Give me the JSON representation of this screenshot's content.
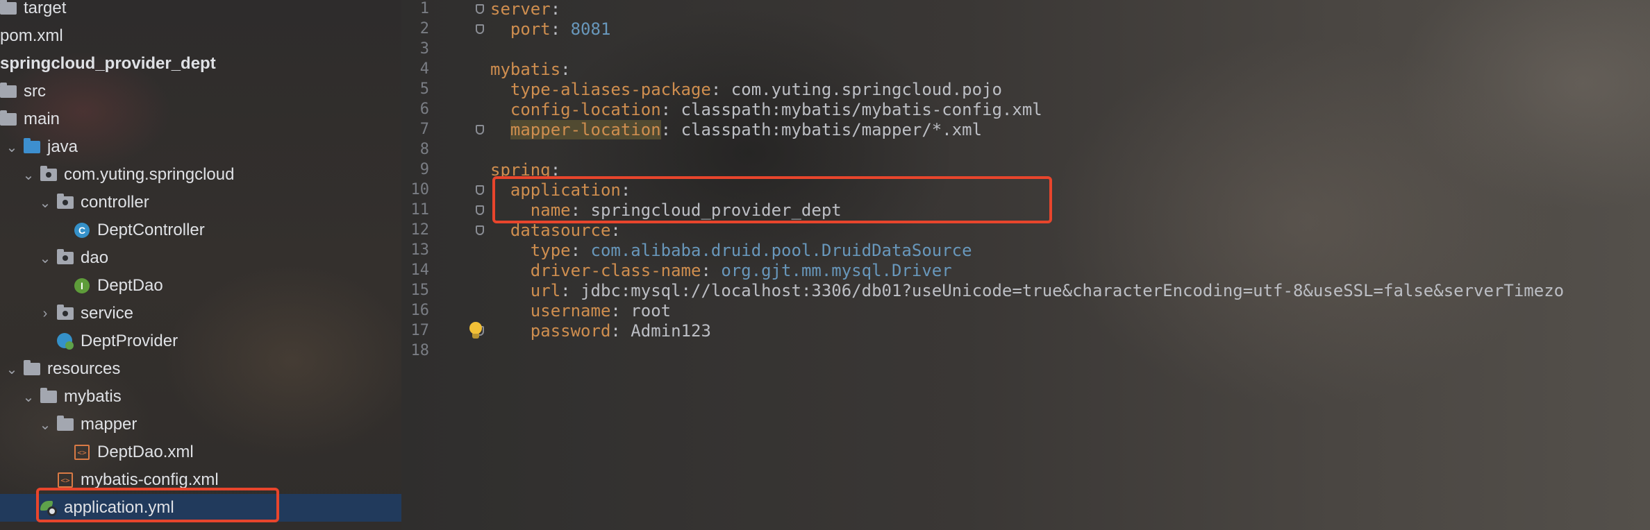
{
  "tree": {
    "rows": [
      {
        "label": "target",
        "indent": 0,
        "icon": "folder"
      },
      {
        "label": "pom.xml",
        "indent": 0,
        "icon": "maven-file"
      },
      {
        "label": "springcloud_provider_dept",
        "indent": 0,
        "icon": "module",
        "bold": true
      },
      {
        "label": "src",
        "indent": 0,
        "icon": "folder"
      },
      {
        "label": "main",
        "indent": 0,
        "icon": "folder"
      },
      {
        "label": "java",
        "indent": 1,
        "icon": "source-folder",
        "expanded": true
      },
      {
        "label": "com.yuting.springcloud",
        "indent": 2,
        "icon": "package",
        "expanded": true
      },
      {
        "label": "controller",
        "indent": 3,
        "icon": "package",
        "expanded": true
      },
      {
        "label": "DeptController",
        "indent": 4,
        "icon": "class"
      },
      {
        "label": "dao",
        "indent": 3,
        "icon": "package",
        "expanded": true
      },
      {
        "label": "DeptDao",
        "indent": 4,
        "icon": "interface"
      },
      {
        "label": "service",
        "indent": 3,
        "icon": "package",
        "expanded": false
      },
      {
        "label": "DeptProvider",
        "indent": 3,
        "icon": "spring-boot-class"
      },
      {
        "label": "resources",
        "indent": 1,
        "icon": "resources-folder",
        "expanded": true
      },
      {
        "label": "mybatis",
        "indent": 2,
        "icon": "folder",
        "expanded": true
      },
      {
        "label": "mapper",
        "indent": 3,
        "icon": "folder",
        "expanded": true
      },
      {
        "label": "DeptDao.xml",
        "indent": 4,
        "icon": "xml-file"
      },
      {
        "label": "mybatis-config.xml",
        "indent": 3,
        "icon": "xml-file"
      },
      {
        "label": "application.yml",
        "indent": 2,
        "icon": "yaml-file",
        "selected": true
      }
    ]
  },
  "editor": {
    "lines": [
      {
        "num": "1",
        "tokens": [
          {
            "t": "server",
            "c": "k"
          },
          {
            "t": ":",
            "c": "p"
          }
        ],
        "fold": true
      },
      {
        "num": "2",
        "tokens": [
          {
            "t": "  port",
            "c": "k"
          },
          {
            "t": ": ",
            "c": "p"
          },
          {
            "t": "8081",
            "c": "n"
          }
        ],
        "fold": true
      },
      {
        "num": "3",
        "tokens": []
      },
      {
        "num": "4",
        "tokens": [
          {
            "t": "mybatis",
            "c": "k"
          },
          {
            "t": ":",
            "c": "p"
          }
        ]
      },
      {
        "num": "5",
        "tokens": [
          {
            "t": "  type-aliases-package",
            "c": "k"
          },
          {
            "t": ": ",
            "c": "p"
          },
          {
            "t": "com.yuting.springcloud.pojo",
            "c": "v"
          }
        ]
      },
      {
        "num": "6",
        "tokens": [
          {
            "t": "  config-location",
            "c": "k"
          },
          {
            "t": ": ",
            "c": "p"
          },
          {
            "t": "classpath:mybatis/mybatis-config.xml",
            "c": "v"
          }
        ]
      },
      {
        "num": "7",
        "tokens": [
          {
            "t": "  ",
            "c": "p"
          },
          {
            "t": "mapper-location",
            "c": "k hl"
          },
          {
            "t": ": ",
            "c": "p"
          },
          {
            "t": "classpath:mybatis/mapper/*.xml",
            "c": "v"
          }
        ],
        "fold": true
      },
      {
        "num": "8",
        "tokens": []
      },
      {
        "num": "9",
        "tokens": [
          {
            "t": "spring",
            "c": "k"
          },
          {
            "t": ":",
            "c": "p"
          }
        ]
      },
      {
        "num": "10",
        "tokens": [
          {
            "t": "  application",
            "c": "k"
          },
          {
            "t": ":",
            "c": "p"
          }
        ],
        "fold": true
      },
      {
        "num": "11",
        "tokens": [
          {
            "t": "    name",
            "c": "k"
          },
          {
            "t": ": ",
            "c": "p"
          },
          {
            "t": "springcloud_provider_dept",
            "c": "v"
          }
        ],
        "fold": true
      },
      {
        "num": "12",
        "tokens": [
          {
            "t": "  datasource",
            "c": "k"
          },
          {
            "t": ":",
            "c": "p"
          }
        ],
        "fold": true
      },
      {
        "num": "13",
        "tokens": [
          {
            "t": "    type",
            "c": "k"
          },
          {
            "t": ": ",
            "c": "p"
          },
          {
            "t": "com.alibaba.druid.pool.DruidDataSource",
            "c": "n"
          }
        ]
      },
      {
        "num": "14",
        "tokens": [
          {
            "t": "    driver-class-name",
            "c": "k"
          },
          {
            "t": ": ",
            "c": "p"
          },
          {
            "t": "org.gjt.mm.mysql.Driver",
            "c": "n"
          }
        ]
      },
      {
        "num": "15",
        "tokens": [
          {
            "t": "    url",
            "c": "k"
          },
          {
            "t": ": ",
            "c": "p"
          },
          {
            "t": "jdbc:mysql://localhost:3306/db01?useUnicode=true&characterEncoding=utf-8&useSSL=false&serverTimezo",
            "c": "v"
          }
        ]
      },
      {
        "num": "16",
        "tokens": [
          {
            "t": "    username",
            "c": "k"
          },
          {
            "t": ": ",
            "c": "p"
          },
          {
            "t": "root",
            "c": "v"
          }
        ]
      },
      {
        "num": "17",
        "tokens": [
          {
            "t": "    password",
            "c": "k"
          },
          {
            "t": ": ",
            "c": "p"
          },
          {
            "t": "Admin123",
            "c": "v"
          }
        ],
        "fold": true,
        "bulb": true
      },
      {
        "num": "18",
        "tokens": []
      }
    ]
  },
  "colors": {
    "highlight_box": "#e8452c",
    "yaml_key": "#cf8e4f",
    "number": "#6897bb",
    "selection": "#213a5c"
  }
}
